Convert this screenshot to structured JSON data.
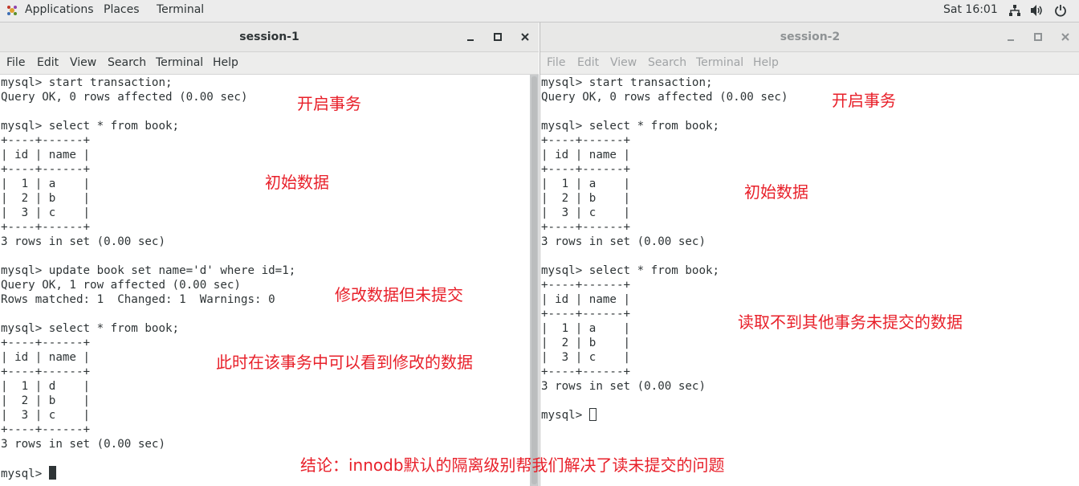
{
  "top_panel": {
    "menus": [
      "Applications",
      "Places",
      "Terminal"
    ],
    "clock": "Sat 16:01",
    "icons": [
      "applications-icon",
      "network-icon",
      "volume-icon",
      "power-icon"
    ]
  },
  "windows": [
    {
      "title": "session-1",
      "menus": [
        "File",
        "Edit",
        "View",
        "Search",
        "Terminal",
        "Help"
      ],
      "active": true,
      "lines": [
        "mysql> start transaction;",
        "Query OK, 0 rows affected (0.00 sec)",
        "",
        "mysql> select * from book;",
        "+----+------+",
        "| id | name |",
        "+----+------+",
        "|  1 | a    |",
        "|  2 | b    |",
        "|  3 | c    |",
        "+----+------+",
        "3 rows in set (0.00 sec)",
        "",
        "mysql> update book set name='d' where id=1;",
        "Query OK, 1 row affected (0.00 sec)",
        "Rows matched: 1  Changed: 1  Warnings: 0",
        "",
        "mysql> select * from book;",
        "+----+------+",
        "| id | name |",
        "+----+------+",
        "|  1 | d    |",
        "|  2 | b    |",
        "|  3 | c    |",
        "+----+------+",
        "3 rows in set (0.00 sec)",
        "",
        "mysql> "
      ]
    },
    {
      "title": "session-2",
      "menus": [
        "File",
        "Edit",
        "View",
        "Search",
        "Terminal",
        "Help"
      ],
      "active": false,
      "lines": [
        "mysql> start transaction;",
        "Query OK, 0 rows affected (0.00 sec)",
        "",
        "mysql> select * from book;",
        "+----+------+",
        "| id | name |",
        "+----+------+",
        "|  1 | a    |",
        "|  2 | b    |",
        "|  3 | c    |",
        "+----+------+",
        "3 rows in set (0.00 sec)",
        "",
        "mysql> select * from book;",
        "+----+------+",
        "| id | name |",
        "+----+------+",
        "|  1 | a    |",
        "|  2 | b    |",
        "|  3 | c    |",
        "+----+------+",
        "3 rows in set (0.00 sec)",
        "",
        "mysql> "
      ]
    }
  ],
  "annotations": {
    "s1_open": "开启事务",
    "s1_initial": "初始数据",
    "s1_modify": "修改数据但未提交",
    "s1_visible": "此时在该事务中可以看到修改的数据",
    "s2_open": "开启事务",
    "s2_initial": "初始数据",
    "s2_cannot_read": "读取不到其他事务未提交的数据",
    "conclusion": "结论：innodb默认的隔离级别帮我们解决了读未提交的问题"
  },
  "colors": {
    "annotation": "#e8202a",
    "terminal_text": "#2e3436"
  }
}
